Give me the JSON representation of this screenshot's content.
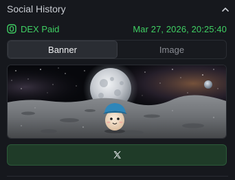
{
  "section": {
    "title": "Social History"
  },
  "status": {
    "label": "DEX Paid",
    "timestamp": "Mar 27, 2026, 20:25:40"
  },
  "tabs": [
    {
      "label": "Banner",
      "active": true
    },
    {
      "label": "Image",
      "active": false
    }
  ],
  "banner": {
    "icon": "moon-landscape-mascot-image"
  },
  "social_button": {
    "icon": "x-logo-icon"
  },
  "colors": {
    "accent_green": "#3fcf63",
    "background": "#16181d",
    "button_bg": "#1f3b28"
  }
}
